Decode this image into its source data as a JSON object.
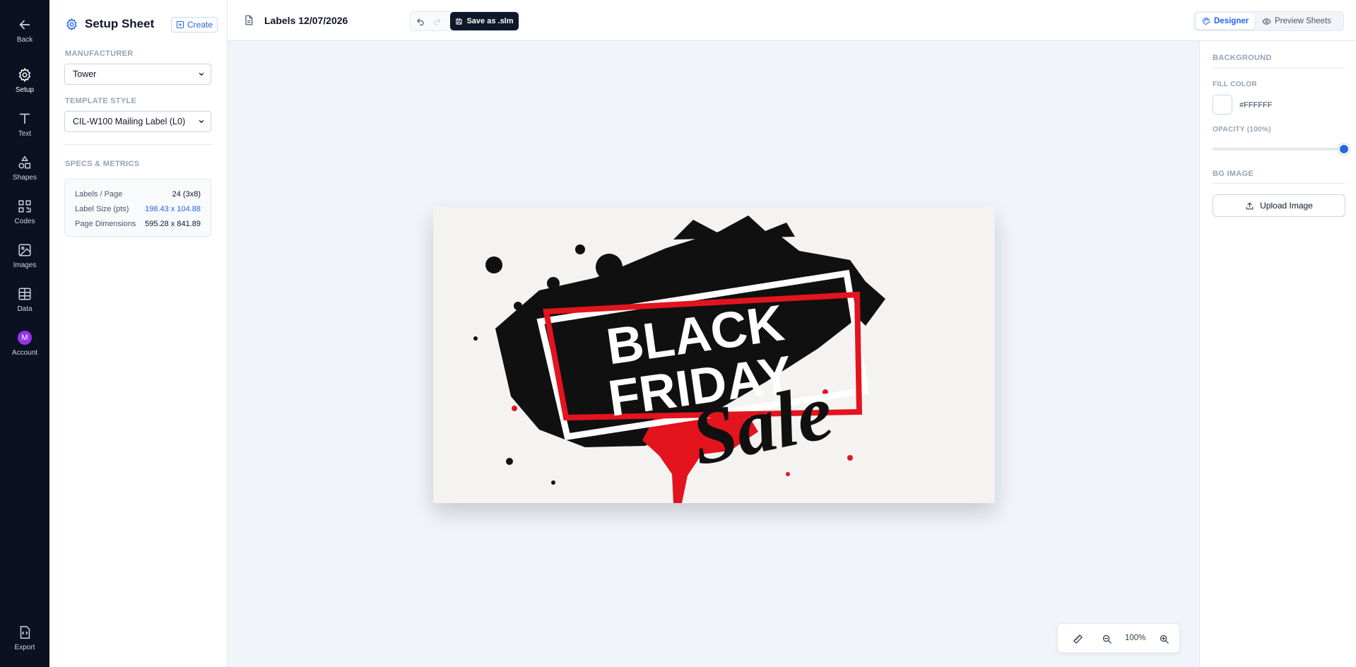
{
  "rail": {
    "back": "Back",
    "setup": "Setup",
    "text": "Text",
    "shapes": "Shapes",
    "codes": "Codes",
    "images": "Images",
    "data": "Data",
    "account": "Account",
    "account_initial": "M",
    "export": "Export"
  },
  "setup_panel": {
    "title": "Setup Sheet",
    "create_label": "Create",
    "manufacturer_label": "MANUFACTURER",
    "manufacturer_value": "Tower",
    "template_label": "TEMPLATE STYLE",
    "template_value": "CIL-W100 Mailing Label (L0)",
    "specs_label": "SPECS & METRICS",
    "specs": [
      {
        "key": "Labels / Page",
        "value": "24 (3x8)"
      },
      {
        "key": "Label Size (pts)",
        "value": "198.43 x 104.88"
      },
      {
        "key": "Page Dimensions",
        "value": "595.28 x 841.89"
      }
    ]
  },
  "topbar": {
    "doc_title": "Labels 12/07/2026",
    "save_label": "Save as .slm",
    "designer_label": "Designer",
    "preview_label": "Preview Sheets"
  },
  "canvas": {
    "label_image": {
      "line1": "BLACK",
      "line2": "FRIDAY",
      "line3": "Sale"
    },
    "zoom": "100%"
  },
  "properties": {
    "background_heading": "BACKGROUND",
    "fill_color_label": "FILL COLOR",
    "fill_color_value": "#FFFFFF",
    "opacity_label": "OPACITY (100%)",
    "opacity_value": 1.0,
    "bg_image_heading": "BG IMAGE",
    "upload_label": "Upload Image"
  },
  "colors": {
    "rail_bg": "#0b1120",
    "accent": "#2563eb",
    "save_bg": "#0f172a",
    "avatar": "#9333ea",
    "sale_red": "#e3141e"
  }
}
